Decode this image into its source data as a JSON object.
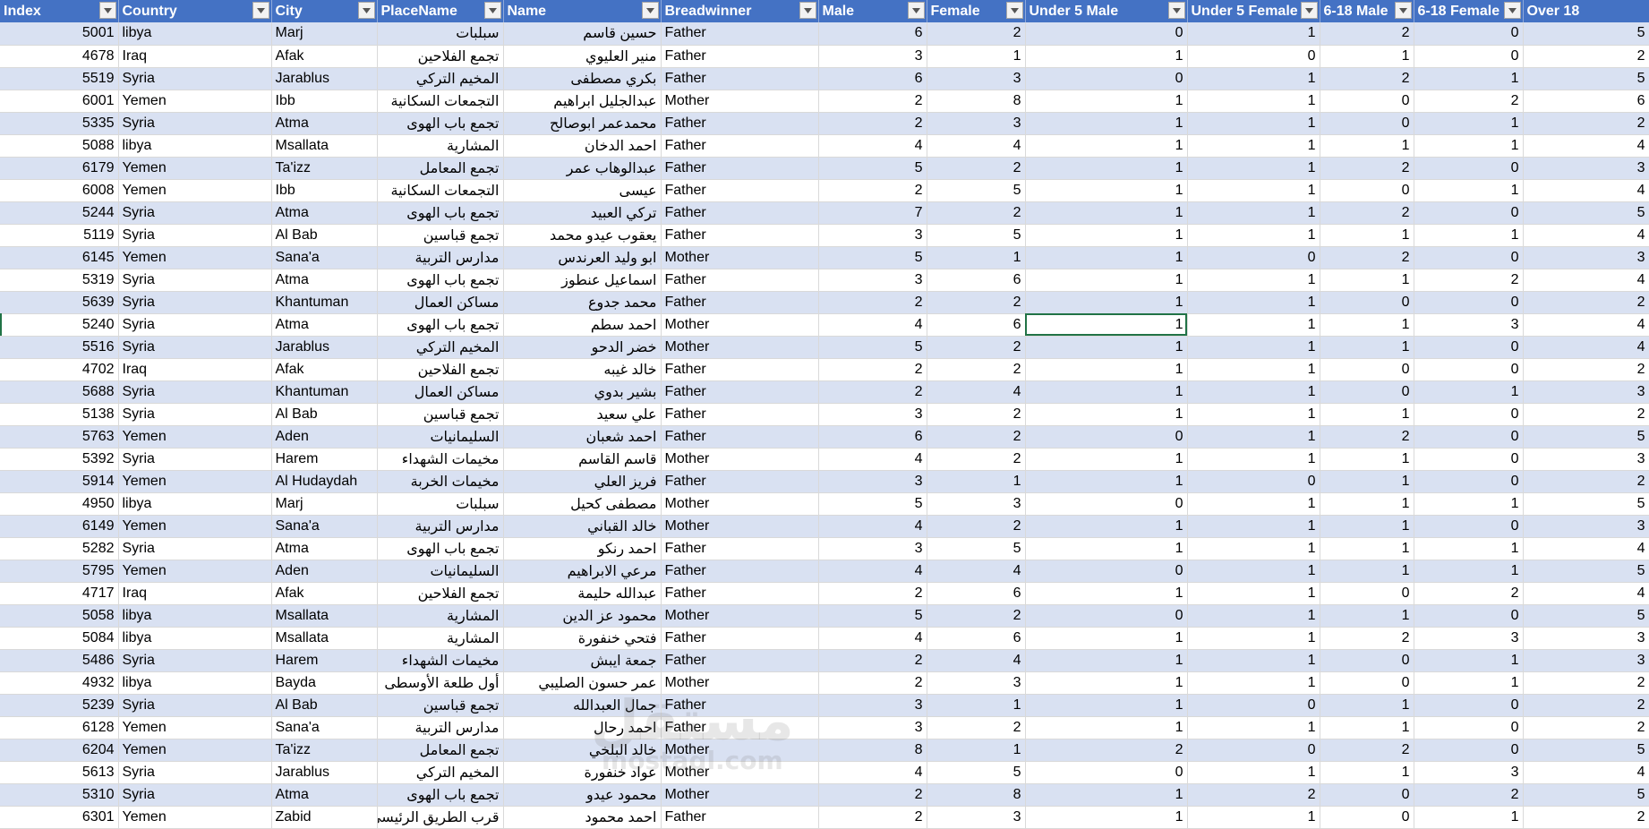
{
  "sheet": {
    "columns": [
      "Index",
      "Country",
      "City",
      "PlaceName",
      "Name",
      "Breadwinner",
      "Male",
      "Female",
      "Under 5 Male",
      "Under 5 Female",
      "6-18 Male",
      "6-18 Female",
      "Over 18"
    ],
    "rows": [
      [
        "5001",
        "libya",
        "Marj",
        "سبلبات",
        "حسين قاسم",
        "Father",
        "6",
        "2",
        "0",
        "1",
        "2",
        "0",
        "5"
      ],
      [
        "4678",
        "Iraq",
        "Afak",
        "تجمع الفلاحين",
        "منير العليوي",
        "Father",
        "3",
        "1",
        "1",
        "0",
        "1",
        "0",
        "2"
      ],
      [
        "5519",
        "Syria",
        "Jarablus",
        "المخيم التركي",
        "بكري مصطفى",
        "Father",
        "6",
        "3",
        "0",
        "1",
        "2",
        "1",
        "5"
      ],
      [
        "6001",
        "Yemen",
        "Ibb",
        "التجمعات السكانية",
        "عبدالجليل ابراهيم",
        "Mother",
        "2",
        "8",
        "1",
        "1",
        "0",
        "2",
        "6"
      ],
      [
        "5335",
        "Syria",
        "Atma",
        "تجمع باب الهوى",
        "محمدعمر  ابوصالح",
        "Father",
        "2",
        "3",
        "1",
        "1",
        "0",
        "1",
        "2"
      ],
      [
        "5088",
        "libya",
        "Msallata",
        "المشارية",
        "احمد الدخان",
        "Father",
        "4",
        "4",
        "1",
        "1",
        "1",
        "1",
        "4"
      ],
      [
        "6179",
        "Yemen",
        "Ta'izz",
        "تجمع المعامل",
        "عبدالوهاب عمر",
        "Father",
        "5",
        "2",
        "1",
        "1",
        "2",
        "0",
        "3"
      ],
      [
        "6008",
        "Yemen",
        "Ibb",
        "التجمعات السكانية",
        "عيسى",
        "Father",
        "2",
        "5",
        "1",
        "1",
        "0",
        "1",
        "4"
      ],
      [
        "5244",
        "Syria",
        "Atma",
        "تجمع باب الهوى",
        "تركي العبيد",
        "Father",
        "7",
        "2",
        "1",
        "1",
        "2",
        "0",
        "5"
      ],
      [
        "5119",
        "Syria",
        "Al Bab",
        "تجمع قباسين",
        "يعقوب عيدو محمد",
        "Father",
        "3",
        "5",
        "1",
        "1",
        "1",
        "1",
        "4"
      ],
      [
        "6145",
        "Yemen",
        "Sana'a",
        "مدارس التربية",
        "ابو وليد العرندس",
        "Mother",
        "5",
        "1",
        "1",
        "0",
        "2",
        "0",
        "3"
      ],
      [
        "5319",
        "Syria",
        "Atma",
        "تجمع باب الهوى",
        "اسماعيل عنطوز",
        "Father",
        "3",
        "6",
        "1",
        "1",
        "1",
        "2",
        "4"
      ],
      [
        "5639",
        "Syria",
        "Khantuman",
        "مساكن العمال",
        "محمد جدوع",
        "Father",
        "2",
        "2",
        "1",
        "1",
        "0",
        "0",
        "2"
      ],
      [
        "5240",
        "Syria",
        "Atma",
        "تجمع باب الهوى",
        "احمد سطم",
        "Mother",
        "4",
        "6",
        "1",
        "1",
        "1",
        "3",
        "4"
      ],
      [
        "5516",
        "Syria",
        "Jarablus",
        "المخيم التركي",
        "خضر الدحو",
        "Mother",
        "5",
        "2",
        "1",
        "1",
        "1",
        "0",
        "4"
      ],
      [
        "4702",
        "Iraq",
        "Afak",
        "تجمع الفلاحين",
        "خالد غيبه",
        "Father",
        "2",
        "2",
        "1",
        "1",
        "0",
        "0",
        "2"
      ],
      [
        "5688",
        "Syria",
        "Khantuman",
        "مساكن العمال",
        "بشير بدوي",
        "Father",
        "2",
        "4",
        "1",
        "1",
        "0",
        "1",
        "3"
      ],
      [
        "5138",
        "Syria",
        "Al Bab",
        "تجمع قباسين",
        "علي سعيد",
        "Father",
        "3",
        "2",
        "1",
        "1",
        "1",
        "0",
        "2"
      ],
      [
        "5763",
        "Yemen",
        "Aden",
        "السليمانيات",
        "احمد شعبان",
        "Father",
        "6",
        "2",
        "0",
        "1",
        "2",
        "0",
        "5"
      ],
      [
        "5392",
        "Syria",
        "Harem",
        "مخيمات الشهداء",
        "قاسم القاسم",
        "Mother",
        "4",
        "2",
        "1",
        "1",
        "1",
        "0",
        "3"
      ],
      [
        "5914",
        "Yemen",
        "Al Hudaydah",
        "مخيمات الخربة",
        "فريز العلي",
        "Father",
        "3",
        "1",
        "1",
        "0",
        "1",
        "0",
        "2"
      ],
      [
        "4950",
        "libya",
        "Marj",
        "سبلبات",
        "مصطفى كحيل",
        "Mother",
        "5",
        "3",
        "0",
        "1",
        "1",
        "1",
        "5"
      ],
      [
        "6149",
        "Yemen",
        "Sana'a",
        "مدارس التربية",
        "خالد القباني",
        "Mother",
        "4",
        "2",
        "1",
        "1",
        "1",
        "0",
        "3"
      ],
      [
        "5282",
        "Syria",
        "Atma",
        "تجمع باب الهوى",
        "احمد رنكو",
        "Father",
        "3",
        "5",
        "1",
        "1",
        "1",
        "1",
        "4"
      ],
      [
        "5795",
        "Yemen",
        "Aden",
        "السليمانيات",
        "مرعي  الابراهيم",
        "Father",
        "4",
        "4",
        "0",
        "1",
        "1",
        "1",
        "5"
      ],
      [
        "4717",
        "Iraq",
        "Afak",
        "تجمع الفلاحين",
        "عبدالله حليمة",
        "Father",
        "2",
        "6",
        "1",
        "1",
        "0",
        "2",
        "4"
      ],
      [
        "5058",
        "libya",
        "Msallata",
        "المشارية",
        "محمود عز الدين",
        "Mother",
        "5",
        "2",
        "0",
        "1",
        "1",
        "0",
        "5"
      ],
      [
        "5084",
        "libya",
        "Msallata",
        "المشارية",
        "فتحي خنفورة",
        "Father",
        "4",
        "6",
        "1",
        "1",
        "2",
        "3",
        "3"
      ],
      [
        "5486",
        "Syria",
        "Harem",
        "مخيمات الشهداء",
        "جمعة ايبش",
        "Father",
        "2",
        "4",
        "1",
        "1",
        "0",
        "1",
        "3"
      ],
      [
        "4932",
        "libya",
        "Bayda",
        "أول طلعة الأوسطى",
        "عمر حسون الصليبي",
        "Mother",
        "2",
        "3",
        "1",
        "1",
        "0",
        "1",
        "2"
      ],
      [
        "5239",
        "Syria",
        "Al Bab",
        "تجمع قباسين",
        "جمال العبدالله",
        "Father",
        "3",
        "1",
        "1",
        "0",
        "1",
        "0",
        "2"
      ],
      [
        "6128",
        "Yemen",
        "Sana'a",
        "مدارس التربية",
        "احمد رحال",
        "Father",
        "3",
        "2",
        "1",
        "1",
        "1",
        "0",
        "2"
      ],
      [
        "6204",
        "Yemen",
        "Ta'izz",
        "تجمع المعامل",
        "خالد البلخي",
        "Mother",
        "8",
        "1",
        "2",
        "0",
        "2",
        "0",
        "5"
      ],
      [
        "5613",
        "Syria",
        "Jarablus",
        "المخيم التركي",
        "عواد خنفورة",
        "Mother",
        "4",
        "5",
        "0",
        "1",
        "1",
        "3",
        "4"
      ],
      [
        "5310",
        "Syria",
        "Atma",
        "تجمع باب الهوى",
        "محمود عيدو",
        "Mother",
        "2",
        "8",
        "1",
        "2",
        "0",
        "2",
        "5"
      ],
      [
        "6301",
        "Yemen",
        "Zabid",
        "قرب الطريق الرئيسي",
        "احمد محمود",
        "Father",
        "2",
        "3",
        "1",
        "1",
        "0",
        "1",
        "2"
      ]
    ],
    "selected_cell": {
      "row": 13,
      "col": 8
    }
  },
  "watermark": {
    "arabic": "مستقل",
    "latin": "mostaql.com"
  },
  "icons": {
    "filter": "filter-dropdown-icon"
  },
  "colors": {
    "header_bg": "#4472c4",
    "band_bg": "#d9e1f2",
    "selection": "#217346"
  }
}
